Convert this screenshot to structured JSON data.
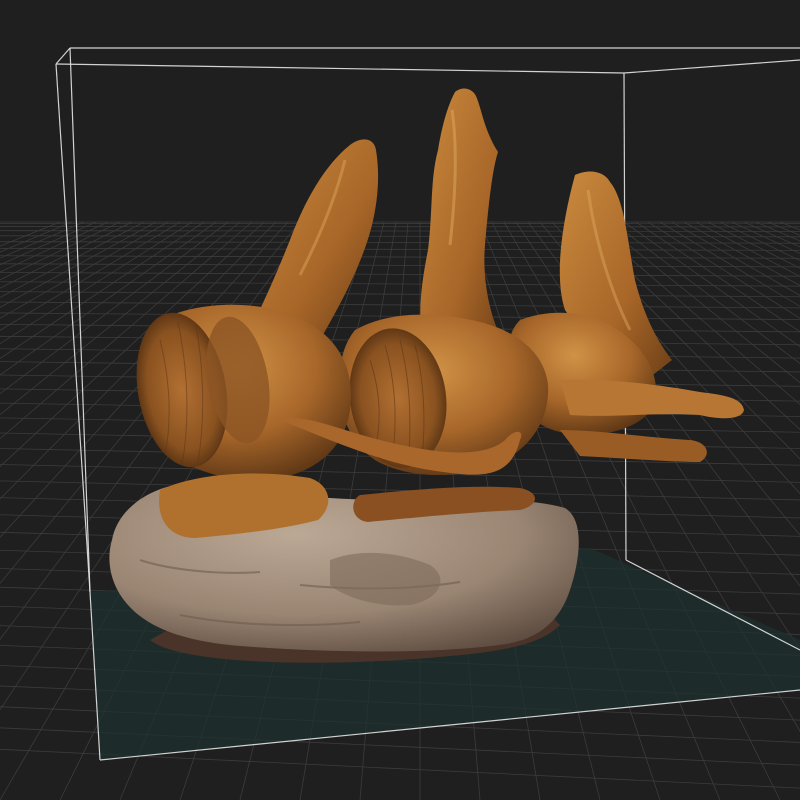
{
  "viewer": {
    "mode": "3d-model-viewport",
    "background_color": "#1f1f1f",
    "grid_color": "#3c3c3c",
    "grid_major_color": "#4a4a4a",
    "floor_tint_color": "#1d302f",
    "bounding_box_color": "#e6e6e6",
    "grid": true,
    "bounding_box": true
  },
  "model": {
    "subject": "fossil-vertebrae",
    "bone_color": "#a8672a",
    "bone_light_color": "#c98a3e",
    "bone_dark_color": "#5a3414",
    "matrix_rock_color": "#9a8573",
    "matrix_rock_light_color": "#b8a593",
    "matrix_rock_dark_color": "#5b4a3e"
  }
}
